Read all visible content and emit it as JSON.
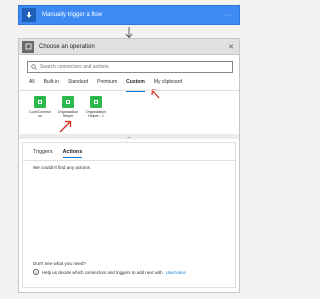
{
  "trigger": {
    "title": "Manually trigger a flow",
    "icon": "manual-trigger-icon",
    "more": "···",
    "color": "#3e8af5"
  },
  "operation": {
    "title": "Choose an operation",
    "close": "✕",
    "search_placeholder": "Search connectors and actions",
    "tabs": [
      "All",
      "Built-in",
      "Standard",
      "Premium",
      "Custom",
      "My clipboard"
    ],
    "active_tab": "Custom",
    "connectors": [
      {
        "label": "CodeConnect oo",
        "icon": "custom-connector-icon"
      },
      {
        "label": "Organization Helper",
        "icon": "custom-connector-icon"
      },
      {
        "label": "Organization Helper - 1",
        "icon": "custom-connector-icon"
      }
    ],
    "connector_color": "#2db84d"
  },
  "lower": {
    "tabs": [
      "Triggers",
      "Actions"
    ],
    "active_tab": "Actions",
    "empty_message": "We couldn't find any actions",
    "help_title": "Don't see what you need?",
    "help_text": "Help us decide which connectors and triggers to add next with",
    "help_link": "UserVoice"
  },
  "accent": "#0078d4",
  "annotation_color": "#d9301f"
}
